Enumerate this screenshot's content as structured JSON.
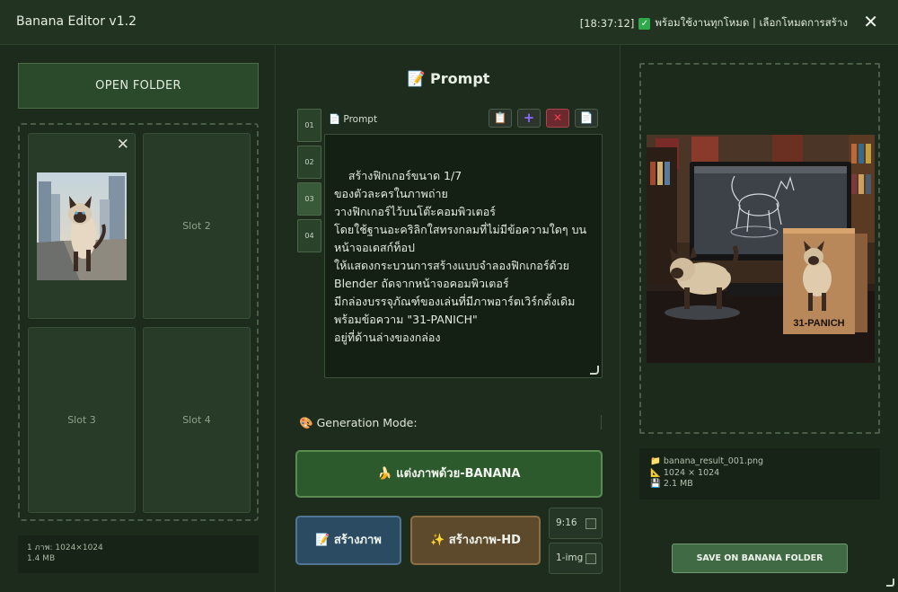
{
  "app": {
    "title": "Banana Editor v1.2",
    "status_time": "[18:37:12]",
    "status_text": "พร้อมใช้งานทุกโหมด | เลือกโหมดการสร้าง",
    "close_glyph": "✕"
  },
  "left": {
    "open_folder_label": "OPEN FOLDER",
    "slots": [
      {
        "label": "",
        "filled": true,
        "remove_glyph": "✕"
      },
      {
        "label": "Slot 2",
        "filled": false
      },
      {
        "label": "Slot 3",
        "filled": false
      },
      {
        "label": "Slot 4",
        "filled": false
      }
    ],
    "info_line1": "1 ภาพ: 1024×1024",
    "info_line2": "1.4 MB"
  },
  "middle": {
    "title": "Prompt",
    "title_icon": "📝",
    "tabs": [
      "01",
      "02",
      "03",
      "04"
    ],
    "active_tab": "03",
    "prompt_label": "Prompt",
    "prompt_icon": "📄",
    "tools": [
      {
        "name": "paste-icon",
        "glyph": "📋"
      },
      {
        "name": "add-icon",
        "glyph": "+"
      },
      {
        "name": "clear-icon",
        "glyph": "✕"
      },
      {
        "name": "document-icon",
        "glyph": "📄"
      }
    ],
    "prompt_text": "สร้างฟิกเกอร์ขนาด 1/7\nของตัวละครในภาพถ่าย\nวางฟิกเกอร์ไว้บนโต๊ะคอมพิวเตอร์\nโดยใช้ฐานอะคริลิกใสทรงกลมที่ไม่มีข้อความใดๆ บนหน้าจอเดสก์ท็อป\nให้แสดงกระบวนการสร้างแบบจำลองฟิกเกอร์ด้วย Blender ถัดจากหน้าจอคอมพิวเตอร์\nมีกล่องบรรจุภัณฑ์ของเล่นที่มีภาพอาร์ตเวิร์กดั้งเดิมพร้อมข้อความ \"31-PANICH\"\nอยู่ที่ด้านล่างของกล่อง",
    "generation_mode_label": "Generation Mode:",
    "generation_mode_icon": "🎨",
    "banana_button": "🍌 แต่งภาพด้วย-BANANA",
    "create_button": "📝 สร้างภาพ",
    "create_hd_button": "✨ สร้างภาพ-HD",
    "option_ratio": "9:16",
    "option_count": "1-img"
  },
  "right": {
    "file_name": "banana_result_001.png",
    "file_dims": "1024 × 1024",
    "file_size": "2.1 MB",
    "file_icon": "📁",
    "dims_icon": "📐",
    "size_icon": "💾",
    "save_button": "SAVE ON BANANA FOLDER",
    "box_text": "31-PANICH"
  },
  "colors": {
    "background": "#1c2a1c",
    "accent_green": "#2d5a2d",
    "create_blue": "#2b4b63",
    "hd_brown": "#5d4a2c",
    "danger_red": "#ff3b4b"
  }
}
